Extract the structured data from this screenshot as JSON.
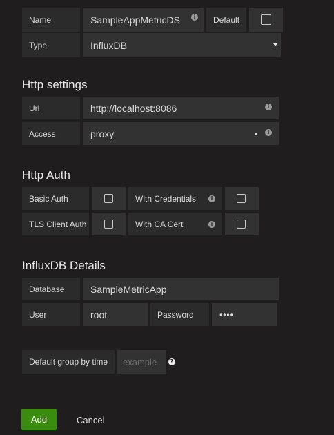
{
  "general": {
    "name_label": "Name",
    "name_value": "SampleAppMetricDS",
    "default_label": "Default",
    "type_label": "Type",
    "type_value": "InfluxDB"
  },
  "http_settings": {
    "title": "Http settings",
    "url_label": "Url",
    "url_value": "http://localhost:8086",
    "access_label": "Access",
    "access_value": "proxy"
  },
  "http_auth": {
    "title": "Http Auth",
    "basic_auth_label": "Basic Auth",
    "with_credentials_label": "With Credentials",
    "tls_client_auth_label": "TLS Client Auth",
    "with_ca_cert_label": "With CA Cert"
  },
  "influxdb": {
    "title": "InfluxDB Details",
    "database_label": "Database",
    "database_value": "SampleMetricApp",
    "user_label": "User",
    "user_value": "root",
    "password_label": "Password",
    "password_value": "••••"
  },
  "group_by": {
    "label": "Default group by time",
    "placeholder": "example"
  },
  "actions": {
    "add_label": "Add",
    "cancel_label": "Cancel"
  },
  "icons": {
    "info": "info-icon",
    "help": "question-icon",
    "caret": "caret-down-icon"
  },
  "colors": {
    "background": "#1f1d1d",
    "add_button": "#3a8c0f"
  }
}
